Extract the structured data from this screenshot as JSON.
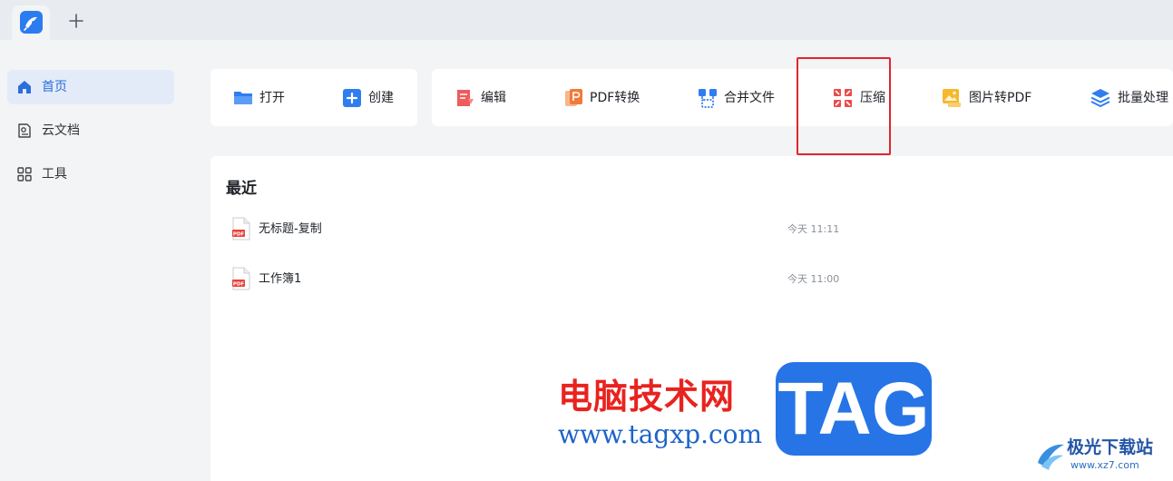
{
  "titlebar": {
    "tab_icon": "app-logo-icon",
    "new_tab_label": "+"
  },
  "sidebar": {
    "items": [
      {
        "label": "首页",
        "icon": "home-icon",
        "active": true
      },
      {
        "label": "云文档",
        "icon": "cloud-document-icon",
        "active": false
      },
      {
        "label": "工具",
        "icon": "tools-grid-icon",
        "active": false
      }
    ]
  },
  "toolbar": {
    "quick": [
      {
        "label": "打开",
        "icon": "folder-open-icon"
      },
      {
        "label": "创建",
        "icon": "create-plus-icon"
      }
    ],
    "tools": [
      {
        "label": "编辑",
        "icon": "edit-icon"
      },
      {
        "label": "PDF转换",
        "icon": "pdf-convert-icon"
      },
      {
        "label": "合并文件",
        "icon": "merge-files-icon"
      },
      {
        "label": "压缩",
        "icon": "compress-icon",
        "highlighted": true
      },
      {
        "label": "图片转PDF",
        "icon": "image-to-pdf-icon"
      },
      {
        "label": "批量处理",
        "icon": "batch-process-icon"
      }
    ]
  },
  "recent": {
    "title": "最近",
    "files": [
      {
        "name": "无标题-复制",
        "time": "今天 11:11",
        "icon": "pdf-file-icon"
      },
      {
        "name": "工作簿1",
        "time": "今天 11:00",
        "icon": "pdf-file-icon"
      }
    ]
  },
  "watermark": {
    "site_name": "电脑技术网",
    "site_url": "www.tagxp.com",
    "tag": "TAG",
    "badge_name": "极光下载站",
    "badge_url": "www.xz7.com"
  },
  "colors": {
    "accent": "#2a7cf0",
    "highlight": "#e0262c",
    "active_bg": "#e4ebf8",
    "watermark_red": "#e8231f",
    "watermark_blue": "#2674e6"
  }
}
